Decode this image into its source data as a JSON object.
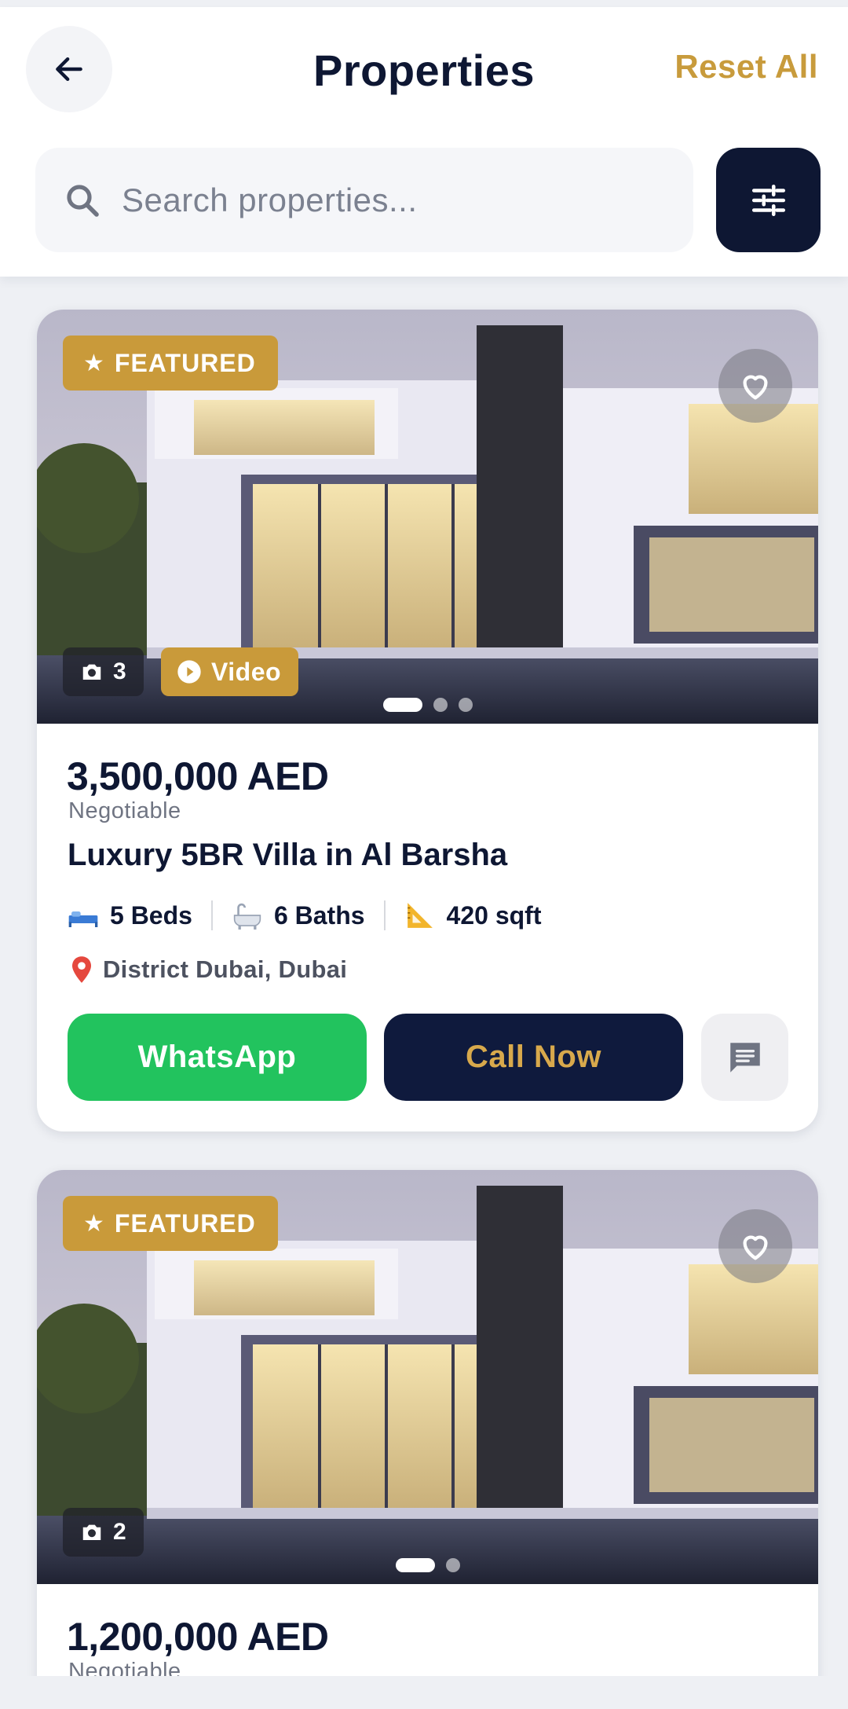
{
  "header": {
    "title": "Properties",
    "reset_label": "Reset All",
    "back_icon": "arrow-left-icon"
  },
  "search": {
    "placeholder": "Search properties...",
    "value": ""
  },
  "filter_icon": "sliders-icon",
  "colors": {
    "navy": "#0e1733",
    "gold": "#c99a3a",
    "whatsapp_green": "#22c35e",
    "background": "#eef0f4"
  },
  "listings": [
    {
      "featured_label": "FEATURED",
      "photo_count": "3",
      "video_label": "Video",
      "slides": 3,
      "active_slide": 1,
      "price": "3,500,000 AED",
      "negotiable": "Negotiable",
      "title": "Luxury 5BR Villa in Al Barsha",
      "beds": "5 Beds",
      "baths": "6 Baths",
      "area": "420 sqft",
      "location": "District Dubai, Dubai",
      "whatsapp_label": "WhatsApp",
      "call_label": "Call Now"
    },
    {
      "featured_label": "FEATURED",
      "photo_count": "2",
      "slides": 2,
      "active_slide": 1,
      "price": "1,200,000 AED",
      "negotiable": "Negotiable"
    }
  ]
}
